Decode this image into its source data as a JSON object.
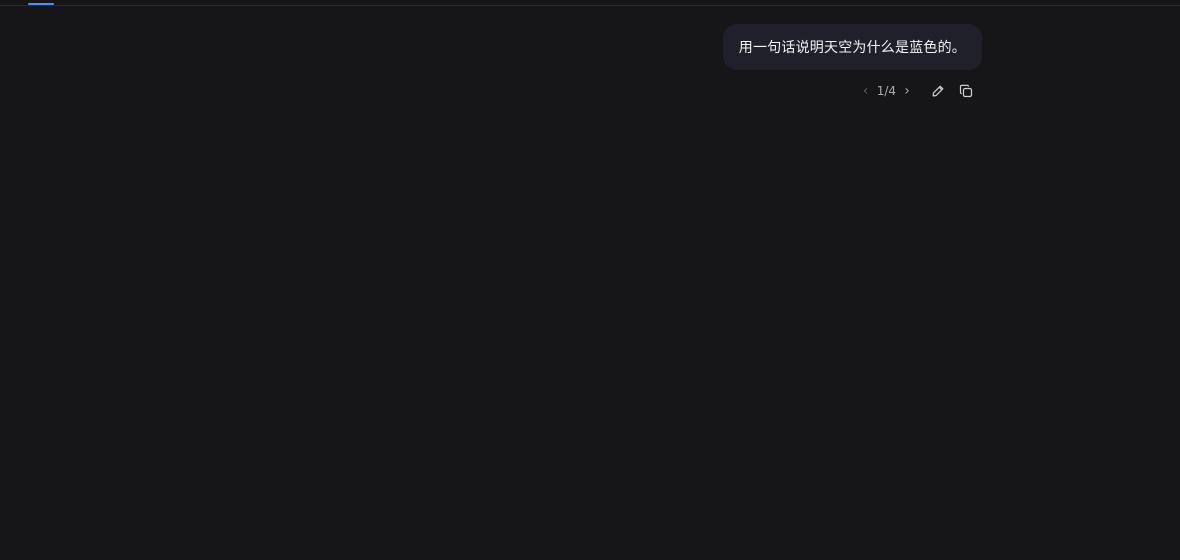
{
  "tabs": {
    "active_color": "#4f8cff"
  },
  "message": {
    "text": "用一句话说明天空为什么是蓝色的。",
    "bubble_color": "#1f202a"
  },
  "actions": {
    "prev_glyph": "‹",
    "next_glyph": "›",
    "page": "1/4",
    "edit_icon": "pencil-icon",
    "copy_icon": "copy-icon",
    "icon_color": "#cfcfd4"
  }
}
